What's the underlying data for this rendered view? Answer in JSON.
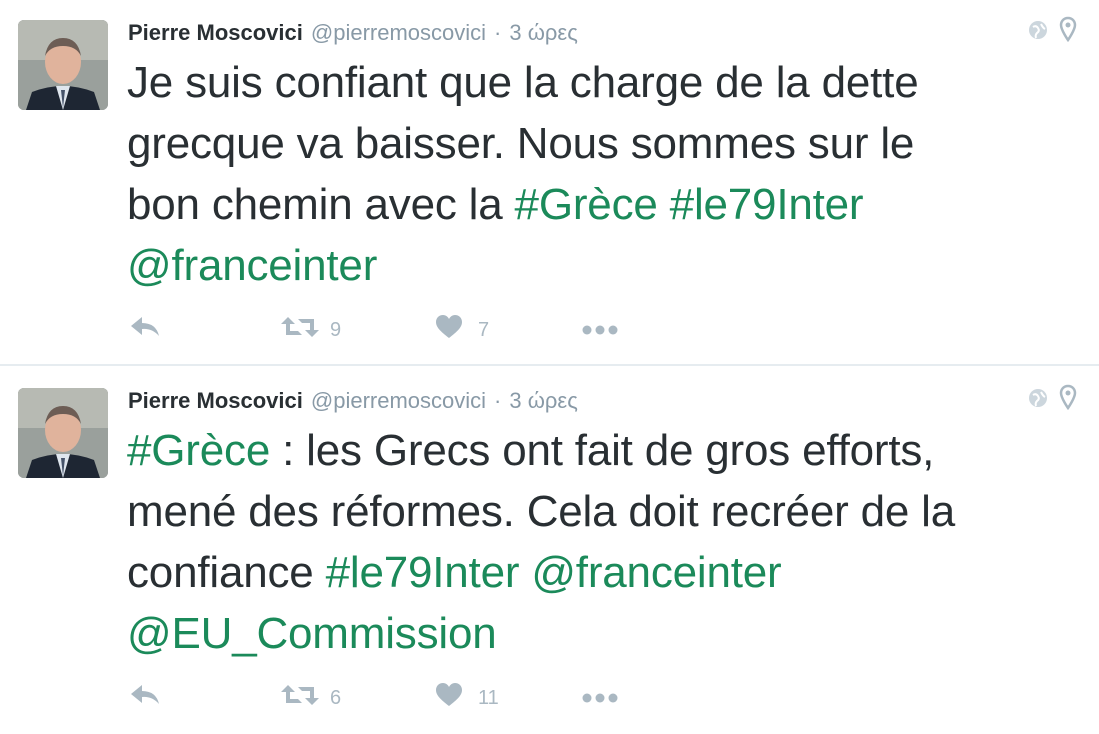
{
  "tweets": [
    {
      "name": "Pierre Moscovici",
      "handle": "@pierremoscovici",
      "sep": "·",
      "time": "3 ώρες",
      "text_parts": [
        {
          "t": "Je suis confiant que la charge de la dette grecque va baisser. Nous sommes sur le bon chemin avec la ",
          "link": false
        },
        {
          "t": "#Grèce",
          "link": true
        },
        {
          "t": " ",
          "link": false
        },
        {
          "t": "#le79Inter",
          "link": true
        },
        {
          "t": " ",
          "link": false
        },
        {
          "t": "@franceinter",
          "link": true
        }
      ],
      "retweets": "9",
      "likes": "7"
    },
    {
      "name": "Pierre Moscovici",
      "handle": "@pierremoscovici",
      "sep": "·",
      "time": "3 ώρες",
      "text_parts": [
        {
          "t": "#Grèce",
          "link": true
        },
        {
          "t": " : les Grecs ont fait de gros efforts, mené des réformes. Cela doit recréer de la confiance ",
          "link": false
        },
        {
          "t": "#le79Inter",
          "link": true
        },
        {
          "t": " ",
          "link": false
        },
        {
          "t": "@franceinter",
          "link": true
        },
        {
          "t": " ",
          "link": false
        },
        {
          "t": "@EU_Commission",
          "link": true
        }
      ],
      "retweets": "6",
      "likes": "11"
    }
  ],
  "icons": {
    "reply": "reply-icon",
    "retweet": "retweet-icon",
    "like": "heart-icon",
    "more": "more-dots-icon",
    "globe": "globe-icon",
    "location": "location-pin-icon"
  },
  "colors": {
    "link": "#1b8a5a",
    "muted": "#8899a6",
    "action": "#aab8c2",
    "text": "#292f33"
  }
}
